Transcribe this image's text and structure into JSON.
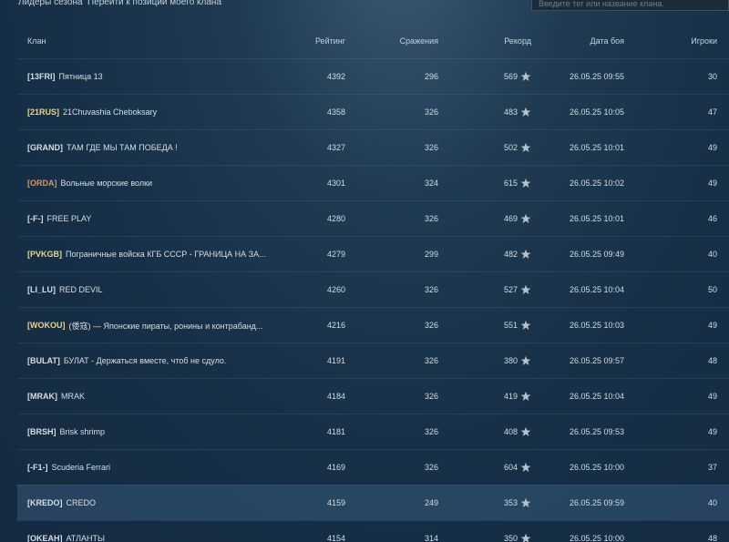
{
  "nav": {
    "season_leaders": "Лидеры сезона",
    "go_to_my_clan": "Перейти к позиции моего клана",
    "search_placeholder": "Введите тег или название клана."
  },
  "columns": {
    "clan": "Клан",
    "rating": "Рейтинг",
    "battles": "Сражения",
    "record": "Рекорд",
    "date": "Дата боя",
    "players": "Игроки"
  },
  "colors": {
    "tag_default": "#d7dee5",
    "tag_gold": "#e8d48a",
    "tag_orange": "#d8955a",
    "star": "#b9c2ca",
    "highlight_row": "#2f5570"
  },
  "rows": [
    {
      "tag": "[13FRI]",
      "tag_color": "#d7dee5",
      "name": "Пятница 13",
      "rating": "4392",
      "battles": "296",
      "record": "569",
      "date": "26.05.25 09:55",
      "players": "30"
    },
    {
      "tag": "[21RUS]",
      "tag_color": "#e8d48a",
      "name": "21Chuvashia Cheboksary",
      "rating": "4358",
      "battles": "326",
      "record": "483",
      "date": "26.05.25 10:05",
      "players": "47"
    },
    {
      "tag": "[GRAND]",
      "tag_color": "#d7dee5",
      "name": "ТАМ ГДЕ МЫ ТАМ ПОБЕДА !",
      "rating": "4327",
      "battles": "326",
      "record": "502",
      "date": "26.05.25 10:01",
      "players": "49"
    },
    {
      "tag": "[ORDA]",
      "tag_color": "#d8955a",
      "name": "Вольные морские волки",
      "rating": "4301",
      "battles": "324",
      "record": "615",
      "date": "26.05.25 10:02",
      "players": "49"
    },
    {
      "tag": "[-F-]",
      "tag_color": "#d7dee5",
      "name": "FREE PLAY",
      "rating": "4280",
      "battles": "326",
      "record": "469",
      "date": "26.05.25 10:01",
      "players": "46"
    },
    {
      "tag": "[PVKGB]",
      "tag_color": "#e8d48a",
      "name": "Пограничные войска КГБ СССР - ГРАНИЦА НА ЗА...",
      "rating": "4279",
      "battles": "299",
      "record": "482",
      "date": "26.05.25 09:49",
      "players": "40"
    },
    {
      "tag": "[LI_LU]",
      "tag_color": "#d7dee5",
      "name": "RED DEVIL",
      "rating": "4260",
      "battles": "326",
      "record": "527",
      "date": "26.05.25 10:04",
      "players": "50"
    },
    {
      "tag": "[WOKOU]",
      "tag_color": "#e8d48a",
      "name": "(倭寇) — Японские пираты, ронины и контрабанд...",
      "rating": "4216",
      "battles": "326",
      "record": "551",
      "date": "26.05.25 10:03",
      "players": "49"
    },
    {
      "tag": "[BULAT]",
      "tag_color": "#d7dee5",
      "name": "БУЛАТ - Держаться вместе, чтоб не сдуло.",
      "rating": "4191",
      "battles": "326",
      "record": "380",
      "date": "26.05.25 09:57",
      "players": "48"
    },
    {
      "tag": "[MRAK]",
      "tag_color": "#d7dee5",
      "name": "MRAK",
      "rating": "4184",
      "battles": "326",
      "record": "419",
      "date": "26.05.25 10:04",
      "players": "49"
    },
    {
      "tag": "[BRSH]",
      "tag_color": "#d7dee5",
      "name": "Brisk shrimp",
      "rating": "4181",
      "battles": "326",
      "record": "408",
      "date": "26.05.25 09:53",
      "players": "49"
    },
    {
      "tag": "[-F1-]",
      "tag_color": "#d7dee5",
      "name": "Scuderia Ferrari",
      "rating": "4169",
      "battles": "326",
      "record": "604",
      "date": "26.05.25 10:00",
      "players": "37"
    },
    {
      "tag": "[KREDO]",
      "tag_color": "#d7dee5",
      "name": "CREDO",
      "rating": "4159",
      "battles": "249",
      "record": "353",
      "date": "26.05.25 09:59",
      "players": "40",
      "highlight": true
    },
    {
      "tag": "[OKEAH]",
      "tag_color": "#d7dee5",
      "name": "АТЛАНТЫ",
      "rating": "4154",
      "battles": "314",
      "record": "350",
      "date": "26.05.25 10:00",
      "players": "48"
    }
  ]
}
